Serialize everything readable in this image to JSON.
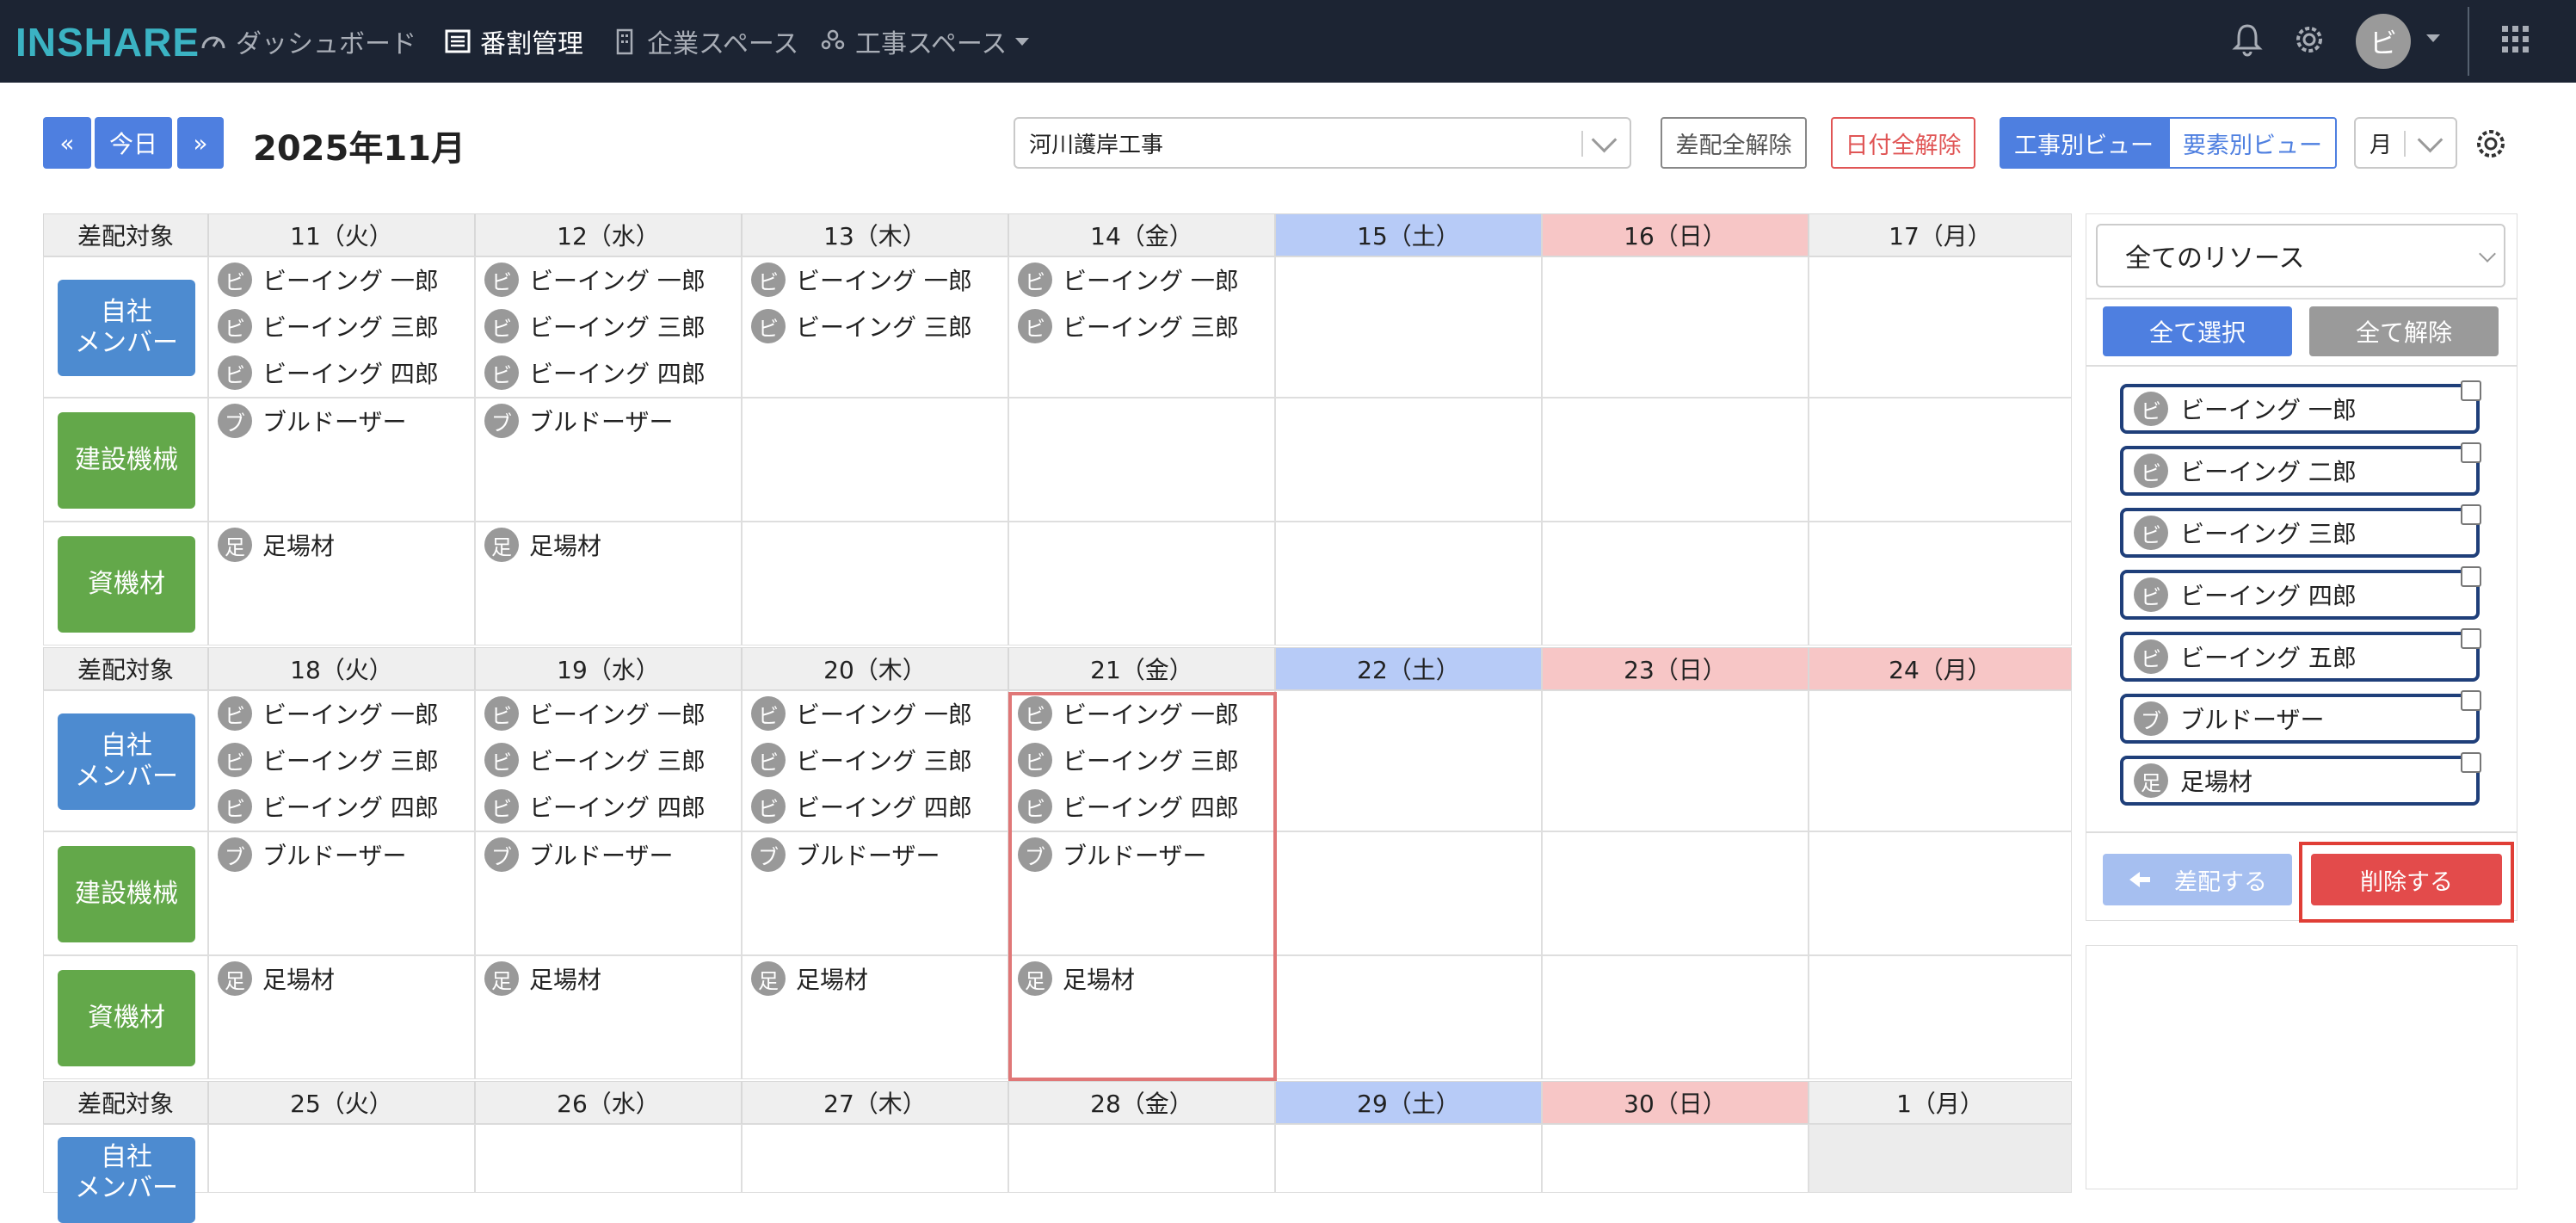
{
  "topbar": {
    "logo": "INSHARE",
    "nav": [
      "ダッシュボード",
      "番割管理",
      "企業スペース",
      "工事スペース"
    ],
    "avatar": "ビ"
  },
  "toolbar": {
    "prev": "«",
    "today": "今日",
    "next": "»",
    "month": "2025年11月",
    "project": "河川護岸工事",
    "clear_assign": "差配全解除",
    "clear_dates": "日付全解除",
    "view_project": "工事別ビュー",
    "view_element": "要素別ビュー",
    "period": "月"
  },
  "calendar": {
    "target_label": "差配対象",
    "categories": [
      "自社\nメンバー",
      "建設機械",
      "資機材"
    ],
    "weeks": [
      {
        "days": [
          "11（火）",
          "12（水）",
          "13（木）",
          "14（金）",
          "15（土）",
          "16（日）",
          "17（月）"
        ],
        "members": [
          [
            "ビーイング 一郎",
            "ビーイング 三郎",
            "ビーイング 四郎"
          ],
          [
            "ビーイング 一郎",
            "ビーイング 三郎",
            "ビーイング 四郎"
          ],
          [
            "ビーイング 一郎",
            "ビーイング 三郎"
          ],
          [
            "ビーイング 一郎",
            "ビーイング 三郎"
          ],
          [],
          [],
          []
        ],
        "machines": [
          [
            "ブルドーザー"
          ],
          [
            "ブルドーザー"
          ],
          [],
          [],
          [],
          [],
          []
        ],
        "materials": [
          [
            "足場材"
          ],
          [
            "足場材"
          ],
          [],
          [],
          [],
          [],
          []
        ]
      },
      {
        "days": [
          "18（火）",
          "19（水）",
          "20（木）",
          "21（金）",
          "22（土）",
          "23（日）",
          "24（月）"
        ],
        "members": [
          [
            "ビーイング 一郎",
            "ビーイング 三郎",
            "ビーイング 四郎"
          ],
          [
            "ビーイング 一郎",
            "ビーイング 三郎",
            "ビーイング 四郎"
          ],
          [
            "ビーイング 一郎",
            "ビーイング 三郎",
            "ビーイング 四郎"
          ],
          [
            "ビーイング 一郎",
            "ビーイング 三郎",
            "ビーイング 四郎"
          ],
          [],
          [],
          []
        ],
        "machines": [
          [
            "ブルドーザー"
          ],
          [
            "ブルドーザー"
          ],
          [
            "ブルドーザー"
          ],
          [
            "ブルドーザー"
          ],
          [],
          [],
          []
        ],
        "materials": [
          [
            "足場材"
          ],
          [
            "足場材"
          ],
          [
            "足場材"
          ],
          [
            "足場材"
          ],
          [],
          [],
          []
        ]
      },
      {
        "days": [
          "25（火）",
          "26（水）",
          "27（木）",
          "28（金）",
          "29（土）",
          "30（日）",
          "1（月）"
        ],
        "members": [
          [],
          [],
          [],
          [],
          [],
          [],
          []
        ]
      }
    ]
  },
  "panel": {
    "resource_select": "全てのリソース",
    "select_all": "全て選択",
    "deselect_all": "全て解除",
    "resources": [
      {
        "avatar": "ビ",
        "name": "ビーイング 一郎"
      },
      {
        "avatar": "ビ",
        "name": "ビーイング 二郎"
      },
      {
        "avatar": "ビ",
        "name": "ビーイング 三郎"
      },
      {
        "avatar": "ビ",
        "name": "ビーイング 四郎"
      },
      {
        "avatar": "ビ",
        "name": "ビーイング 五郎"
      },
      {
        "avatar": "ブ",
        "name": "ブルドーザー"
      },
      {
        "avatar": "足",
        "name": "足場材"
      }
    ],
    "assign": "差配する",
    "delete": "削除する"
  }
}
